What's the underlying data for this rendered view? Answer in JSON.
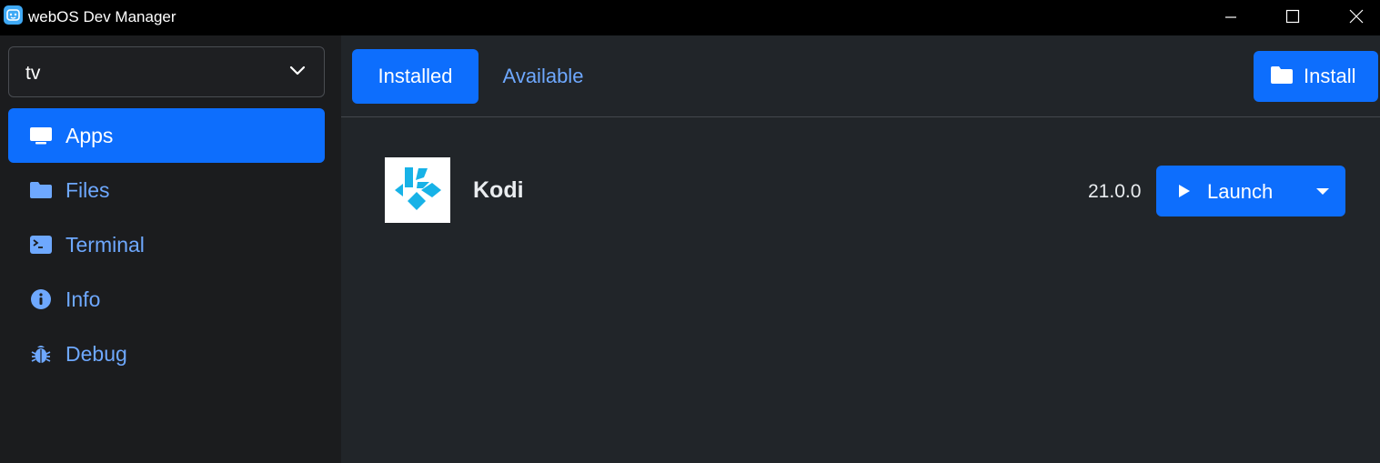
{
  "window": {
    "title": "webOS Dev Manager",
    "controls": [
      "minimize-icon",
      "maximize-icon",
      "close-icon"
    ]
  },
  "sidebar": {
    "device_select": {
      "value": "tv",
      "icon": "chevron-down-icon"
    },
    "items": [
      {
        "label": "Apps",
        "icon": "tv-icon",
        "active": true
      },
      {
        "label": "Files",
        "icon": "folder-icon",
        "active": false
      },
      {
        "label": "Terminal",
        "icon": "terminal-icon",
        "active": false
      },
      {
        "label": "Info",
        "icon": "info-icon",
        "active": false
      },
      {
        "label": "Debug",
        "icon": "bug-icon",
        "active": false
      }
    ]
  },
  "toolbar": {
    "tabs": [
      {
        "label": "Installed",
        "active": true
      },
      {
        "label": "Available",
        "active": false
      }
    ],
    "install_label": "Install",
    "install_icon": "folder-open-icon"
  },
  "apps": [
    {
      "name": "Kodi",
      "version": "21.0.0",
      "icon": "kodi-logo",
      "launch_label": "Launch",
      "launch_icon": "play-icon",
      "toggle_icon": "caret-down-icon"
    }
  ],
  "colors": {
    "accent": "#0d6efd",
    "link": "#6ea8fe",
    "sidebar_bg": "#1b1c1e",
    "main_bg": "#212529",
    "kodi_blue": "#17b2e7"
  }
}
